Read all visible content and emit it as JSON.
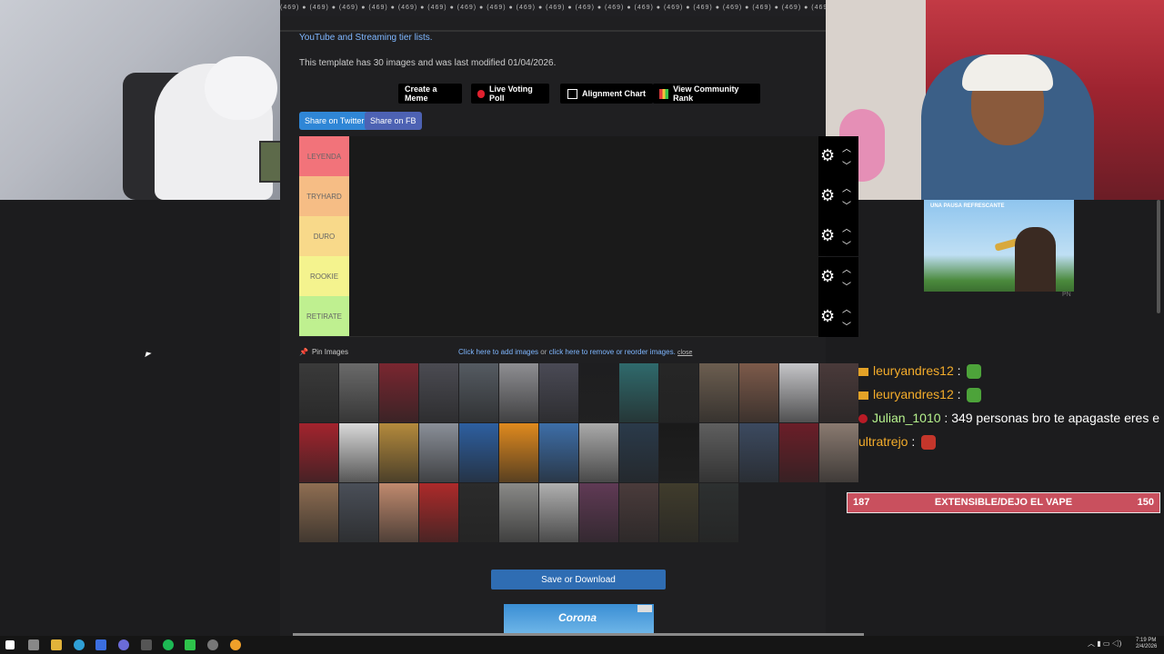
{
  "header": {
    "intro_link": "YouTube and Streaming tier lists.",
    "template_info": "This template has 30 images and was last modified 01/04/2026.",
    "top_strip_text": "(469) ● (469) ● (469) ● (469) ● (469) ● (469) ● (469) ● (469) ● (469) ● (469) ● (469) ● (469) ● (469) ● (469) ● (469) ● (469) ● (469) ● (469) ● (469) ● (469) ● (469) ●"
  },
  "actions": {
    "create_meme": "Create a Meme",
    "live_voting": "Live Voting Poll",
    "alignment_chart": "Alignment Chart",
    "community_rank": "View Community Rank",
    "share_twitter": "Share on Twitter",
    "share_fb": "Share on FB"
  },
  "tiers": [
    {
      "label": "LEYENDA",
      "color": "#f2737a"
    },
    {
      "label": "TRYHARD",
      "color": "#f6bd85"
    },
    {
      "label": "DURO",
      "color": "#f8d98a"
    },
    {
      "label": "ROOKIE",
      "color": "#f4f38e"
    },
    {
      "label": "RETIRATE",
      "color": "#bff090"
    }
  ],
  "image_pool": {
    "pin_label": "Pin Images",
    "add_prefix": "Click here to add images",
    "or_text": "or",
    "remove_link": "click here to remove or reorder images.",
    "close_link": "close",
    "thumb_colors": [
      "#3a3a3a",
      "#6a6a6a",
      "#7a2630",
      "#4b4b52",
      "#555b62",
      "#8e8e92",
      "#4a4a55",
      "#1e1e20",
      "#2f6a6c",
      "#262626",
      "#6c5e50",
      "#7d5a4a",
      "#c5c5c8",
      "#4a3a3a",
      "#a3232d",
      "#d9d9d9",
      "#b48a3c",
      "#8a8f98",
      "#2d5fa0",
      "#e08a1e",
      "#3d6ea8",
      "#aaaaaa",
      "#2a3a4a",
      "#1a1a1a",
      "#5f5f5f",
      "#3c4a60",
      "#6b1e28",
      "#8a7a70",
      "#8f6e52",
      "#4a4f58",
      "#c08a6e",
      "#ad2a2a",
      "#2b2b2b",
      "#8a8a88",
      "#b0b0b0",
      "#603a55",
      "#4a3b3b",
      "#403c2c",
      "#2d3030"
    ]
  },
  "save_button": "Save or Download",
  "ad": {
    "side_title": "UNA PAUSA REFRESCANTE",
    "pn": "PN",
    "corona_text": "Corona"
  },
  "chat": [
    {
      "user": "leuryandres12",
      "sep": " : ",
      "msg": ""
    },
    {
      "user": "leuryandres12",
      "sep": " : ",
      "msg": ""
    },
    {
      "user": "Julian_1010",
      "sep": " : ",
      "msg": "349 personas bro te apagaste eres e"
    },
    {
      "user": "ultratrejo",
      "sep": " : ",
      "msg": ""
    }
  ],
  "goal_bar": {
    "left": "187",
    "center": "EXTENSIBLE/DEJO EL VAPE",
    "right": "150"
  },
  "clock": {
    "time": "7:19 PM",
    "date": "2/4/2026"
  }
}
